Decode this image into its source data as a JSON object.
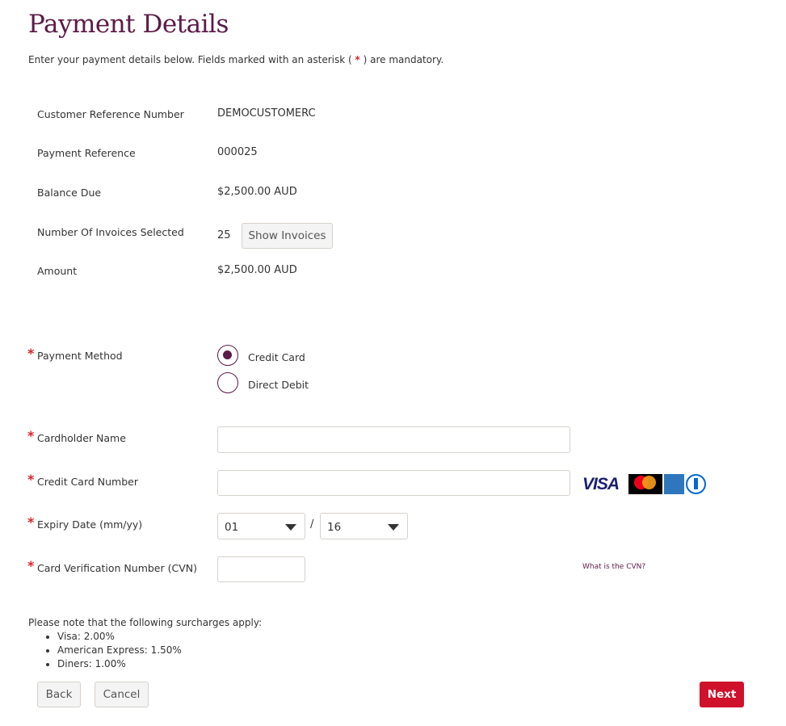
{
  "page": {
    "title": "Payment Details",
    "intro_before": "Enter your payment details below. Fields marked with an asterisk (",
    "intro_star": "*",
    "intro_after": ") are mandatory."
  },
  "summary": [
    {
      "label": "Customer Reference Number",
      "value": "DEMOCUSTOMERC"
    },
    {
      "label": "Payment Reference",
      "value": "000025"
    },
    {
      "label": "Balance Due",
      "value": "$2,500.00 AUD"
    },
    {
      "label": "Number Of Invoices Selected",
      "value": "25",
      "button": "Show Invoices"
    },
    {
      "label": "Amount",
      "value": "$2,500.00 AUD"
    }
  ],
  "form": {
    "required_mark": "*",
    "payment_method": {
      "label": "Payment Method",
      "options": [
        "Credit Card",
        "Direct Debit"
      ],
      "selected": "Credit Card"
    },
    "cardholder": {
      "label": "Cardholder Name",
      "value": ""
    },
    "card_number": {
      "label": "Credit Card Number",
      "value": "",
      "card_icons": [
        "visa-icon",
        "mastercard-icon",
        "amex-icon",
        "diners-icon"
      ]
    },
    "expiry": {
      "label": "Expiry Date (mm/yy)",
      "month": "01",
      "separator": "/",
      "year": "16"
    },
    "cvn": {
      "label": "Card Verification Number (CVN)",
      "value": "",
      "help_link": "What is the CVN?"
    }
  },
  "surcharges": {
    "intro": "Please note that the following surcharges apply:",
    "items": [
      "Visa: 2.00%",
      "American Express: 1.50%",
      "Diners: 1.00%"
    ]
  },
  "actions": {
    "back": "Back",
    "cancel": "Cancel",
    "next": "Next"
  },
  "colors": {
    "brand": "#5c1a47",
    "accent": "#d0112b",
    "required": "#e0202b"
  }
}
